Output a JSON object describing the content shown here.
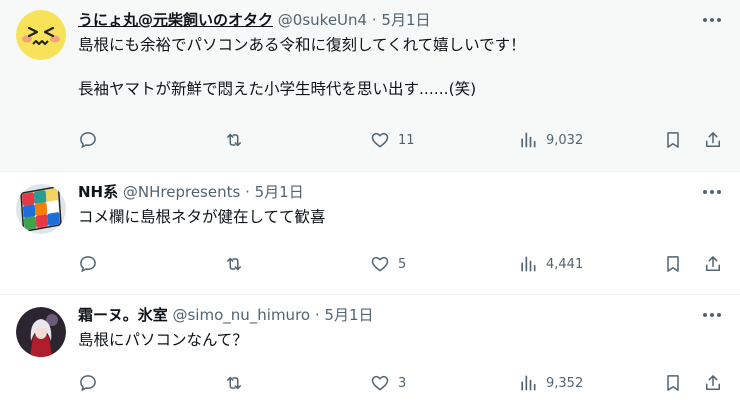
{
  "tweets": [
    {
      "name": "うにょ丸@元柴飼いのオタク",
      "handle": "@0sukeUn4",
      "dot": "·",
      "date": "5月1日",
      "text_lines": [
        "島根にも余裕でパソコンある令和に復刻してくれて嬉しいです！",
        "長袖ヤマトが新鮮で悶えた小学生時代を思い出す......(笑)"
      ],
      "likes": "11",
      "views": "9,032"
    },
    {
      "name": "NH系",
      "handle": "@NHrepresents",
      "dot": "·",
      "date": "5月1日",
      "text_lines": [
        "コメ欄に島根ネタが健在してて歓喜"
      ],
      "likes": "5",
      "views": "4,441"
    },
    {
      "name": "霜ーヌ。氷室",
      "handle": "@simo_nu_himuro",
      "dot": "·",
      "date": "5月1日",
      "text_lines": [
        "島根にパソコンなんて？"
      ],
      "likes": "3",
      "views": "9,352"
    }
  ],
  "icons": {
    "reply": "reply-icon",
    "retweet": "retweet-icon",
    "like": "heart-icon",
    "views": "views-icon",
    "bookmark": "bookmark-icon",
    "share": "share-icon",
    "more": "more-icon"
  },
  "colors": {
    "text": "#0f1419",
    "secondary": "#536471",
    "highlight_bg": "#f7f9f9",
    "border": "#eff3f4"
  }
}
